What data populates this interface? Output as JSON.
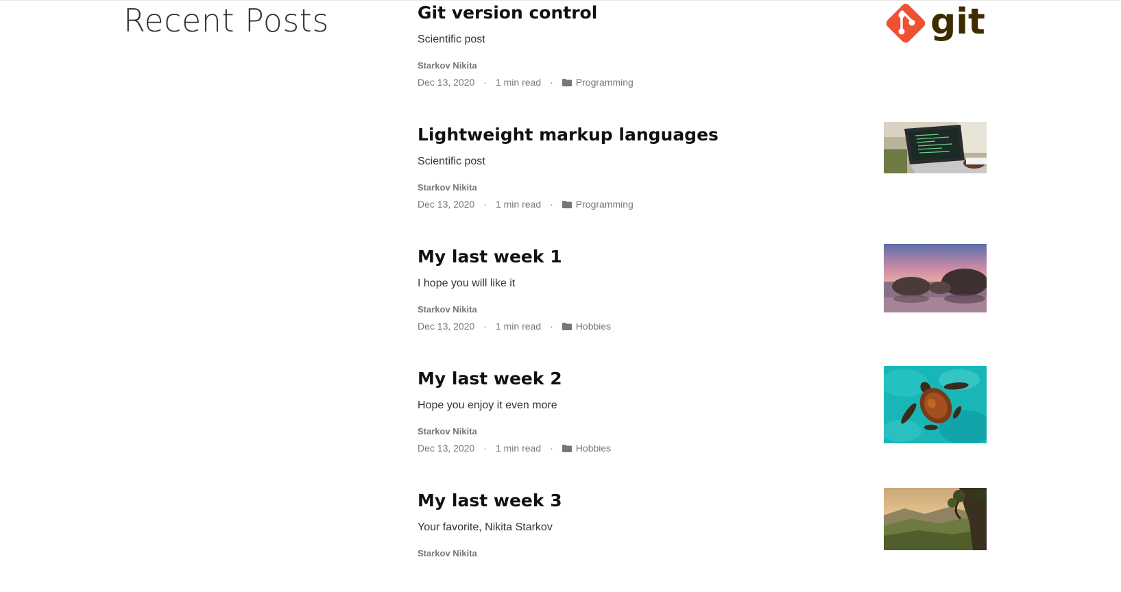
{
  "section": {
    "title": "Recent Posts"
  },
  "posts": [
    {
      "title": "Git version control",
      "subtitle": "Scientific post",
      "author": "Starkov Nikita",
      "date": "Dec 13, 2020",
      "read_time": "1 min read",
      "category": "Programming",
      "thumbnail": "git-logo"
    },
    {
      "title": "Lightweight markup languages",
      "subtitle": "Scientific post",
      "author": "Starkov Nikita",
      "date": "Dec 13, 2020",
      "read_time": "1 min read",
      "category": "Programming",
      "thumbnail": "laptop-code-photo"
    },
    {
      "title": "My last week 1",
      "subtitle": "I hope you will like it",
      "author": "Starkov Nikita",
      "date": "Dec 13, 2020",
      "read_time": "1 min read",
      "category": "Hobbies",
      "thumbnail": "beach-boulders-photo"
    },
    {
      "title": "My last week 2",
      "subtitle": "Hope you enjoy it even more",
      "author": "Starkov Nikita",
      "date": "Dec 13, 2020",
      "read_time": "1 min read",
      "category": "Hobbies",
      "thumbnail": "sea-turtle-photo"
    },
    {
      "title": "My last week 3",
      "subtitle": "Your favorite, Nikita Starkov",
      "author": "Starkov Nikita",
      "thumbnail": "mountain-valley-photo"
    }
  ],
  "meta": {
    "separator": "·",
    "category_icon": "folder-icon"
  },
  "colors": {
    "git_brand": "#f05133",
    "git_text": "#3e2c00",
    "meta_text": "#777777",
    "title_text": "#111111"
  },
  "logo_text": "git"
}
